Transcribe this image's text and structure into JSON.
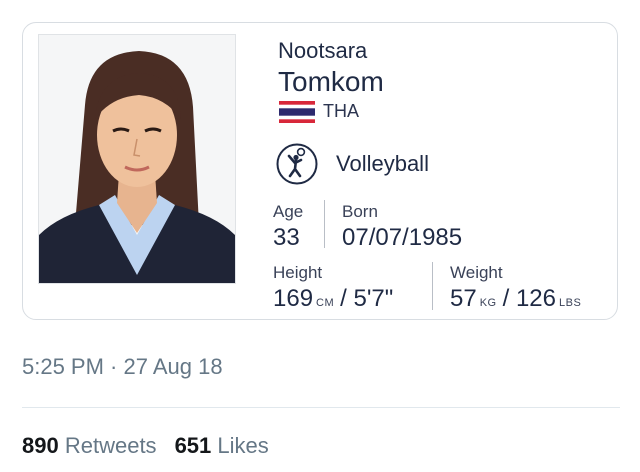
{
  "card": {
    "first_name": "Nootsara",
    "last_name": "Tomkom",
    "country_code": "THA",
    "sport": "Volleyball",
    "sport_icon": "volleyball-player-icon",
    "flag_icon": "thailand-flag-icon",
    "age_label": "Age",
    "age_value": "33",
    "born_label": "Born",
    "born_value": "07/07/1985",
    "height_label": "Height",
    "height_cm": "169",
    "height_cm_unit": "CM",
    "height_sep": "/",
    "height_ft": "5'7\"",
    "weight_label": "Weight",
    "weight_kg": "57",
    "weight_kg_unit": "KG",
    "weight_sep": "/",
    "weight_lbs": "126",
    "weight_lbs_unit": "LBS"
  },
  "tweet": {
    "timestamp": "5:25 PM · 27 Aug 18",
    "retweets_count": "890",
    "retweets_label": "Retweets",
    "likes_count": "651",
    "likes_label": "Likes"
  },
  "colors": {
    "flag_red": "#d8283a",
    "flag_white": "#ffffff",
    "flag_blue": "#2d2a6e",
    "text_secondary": "#657786"
  }
}
